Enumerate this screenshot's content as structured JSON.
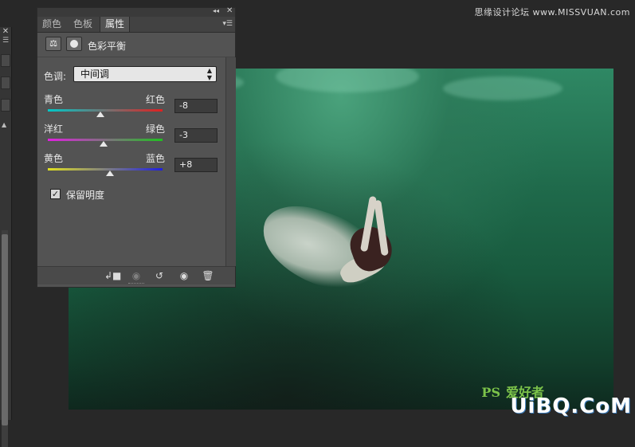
{
  "watermark": {
    "top_text": "思缘设计论坛 www.MISSVUAN.com",
    "ps_text": "PS",
    "ps_suffix": "爱好者",
    "site": "UiBQ.CoM"
  },
  "panel": {
    "tabs": [
      {
        "label": "颜色",
        "active": false
      },
      {
        "label": "色板",
        "active": false
      },
      {
        "label": "属性",
        "active": true
      }
    ],
    "title": "色彩平衡",
    "tone": {
      "label": "色调:",
      "value": "中间调"
    },
    "sliders": [
      {
        "left_label": "青色",
        "right_label": "红色",
        "value": "-8",
        "level": -8,
        "gradient": [
          "#00c8c8",
          "#e02020"
        ]
      },
      {
        "left_label": "洋红",
        "right_label": "绿色",
        "value": "-3",
        "level": -3,
        "gradient": [
          "#e020e0",
          "#20c020"
        ]
      },
      {
        "left_label": "黄色",
        "right_label": "蓝色",
        "value": "+8",
        "level": 8,
        "gradient": [
          "#e0e020",
          "#2020e0"
        ]
      }
    ],
    "preserve_luminosity": {
      "label": "保留明度",
      "checked": true
    },
    "footer_icons": [
      "clip-to-layer-icon",
      "view-previous-icon",
      "reset-icon",
      "visibility-icon",
      "trash-icon"
    ]
  }
}
